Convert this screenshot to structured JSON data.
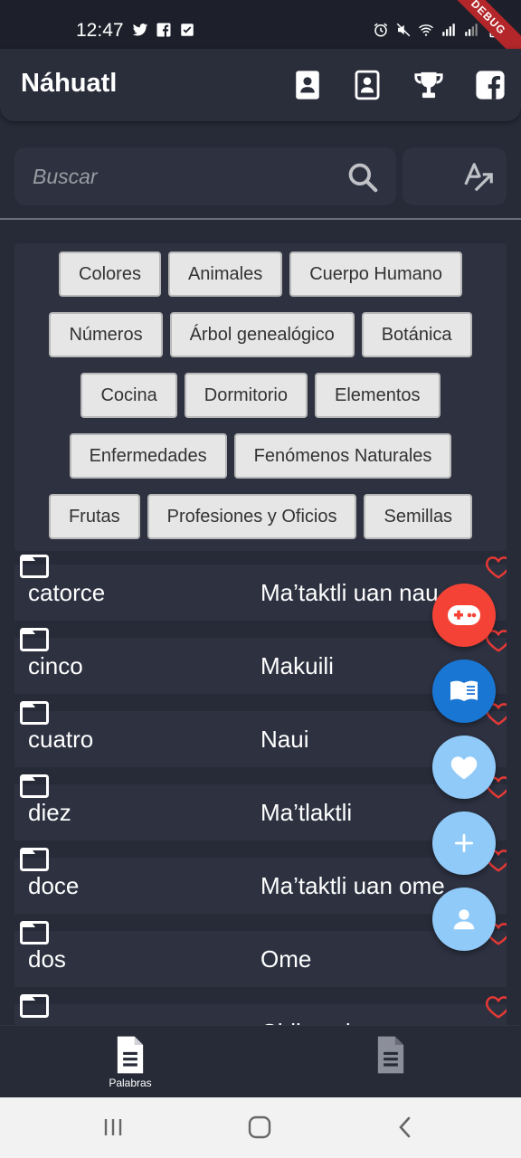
{
  "status_bar": {
    "time": "12:47",
    "debug_label": "DEBUG",
    "left_icons": [
      "twitter-icon",
      "facebook-icon",
      "check-box-icon"
    ],
    "right_icons": [
      "alarm-icon",
      "mute-icon",
      "wifi-icon",
      "signal-icon",
      "signal-icon",
      "battery-icon"
    ]
  },
  "app_bar": {
    "title": "Náhuatl",
    "actions": [
      "contacts-book-icon",
      "contacts-book-outline-icon",
      "trophy-icon",
      "facebook-icon"
    ]
  },
  "search": {
    "placeholder": "Buscar"
  },
  "categories": {
    "rows": [
      [
        "Colores",
        "Animales",
        "Cuerpo Humano"
      ],
      [
        "Números",
        "Árbol genealógico",
        "Botánica"
      ],
      [
        "Cocina",
        "Dormitorio",
        "Elementos"
      ],
      [
        "Enfermedades",
        "Fenómenos Naturales"
      ],
      [
        "Frutas",
        "Profesiones y Oficios",
        "Semillas"
      ]
    ]
  },
  "words": [
    {
      "spanish": "catorce",
      "nahuatl": "Ma’taktli uan nau"
    },
    {
      "spanish": "cinco",
      "nahuatl": "Makuili"
    },
    {
      "spanish": "cuatro",
      "nahuatl": "Naui"
    },
    {
      "spanish": "diez",
      "nahuatl": "Ma’tlaktli"
    },
    {
      "spanish": "doce",
      "nahuatl": "Ma’taktli uan ome"
    },
    {
      "spanish": "dos",
      "nahuatl": "Ome"
    },
    {
      "spanish": "",
      "nahuatl": "Chikuesi"
    }
  ],
  "fabs": [
    {
      "icon": "gamepad-icon",
      "color": "#f44336"
    },
    {
      "icon": "book-icon",
      "color": "#1976d2"
    },
    {
      "icon": "heart-icon",
      "color": "#90caf9"
    },
    {
      "icon": "plus-icon",
      "color": "#90caf9"
    },
    {
      "icon": "person-icon",
      "color": "#90caf9"
    }
  ],
  "bottom_nav": {
    "items": [
      {
        "label": "Palabras",
        "icon": "document-icon"
      },
      {
        "label": "",
        "icon": "document-icon"
      }
    ]
  },
  "system_nav": [
    "recents-icon",
    "home-icon",
    "back-icon"
  ]
}
